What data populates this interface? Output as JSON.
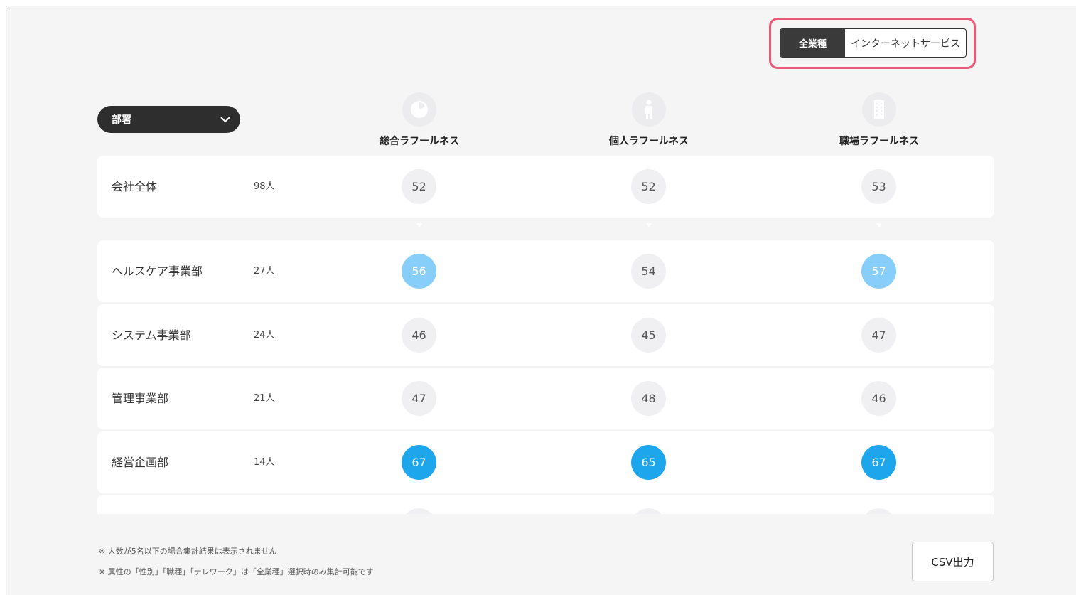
{
  "industry_toggle": {
    "active": "全業種",
    "inactive": "インターネットサービス"
  },
  "dept_select": {
    "value": "部署"
  },
  "columns": [
    {
      "label": "総合ラフールネス",
      "icon": "pie-icon"
    },
    {
      "label": "個人ラフールネス",
      "icon": "person-icon"
    },
    {
      "label": "職場ラフールネス",
      "icon": "building-icon"
    }
  ],
  "rows": [
    {
      "name": "会社全体",
      "count": "98人",
      "scores": [
        "52",
        "52",
        "53"
      ],
      "levels": [
        "neutral",
        "neutral",
        "neutral"
      ]
    },
    {
      "name": "ヘルスケア事業部",
      "count": "27人",
      "scores": [
        "56",
        "54",
        "57"
      ],
      "levels": [
        "light",
        "neutral",
        "light"
      ]
    },
    {
      "name": "システム事業部",
      "count": "24人",
      "scores": [
        "46",
        "45",
        "47"
      ],
      "levels": [
        "neutral",
        "neutral",
        "neutral"
      ]
    },
    {
      "name": "管理事業部",
      "count": "21人",
      "scores": [
        "47",
        "48",
        "46"
      ],
      "levels": [
        "neutral",
        "neutral",
        "neutral"
      ]
    },
    {
      "name": "経営企画部",
      "count": "14人",
      "scores": [
        "67",
        "65",
        "67"
      ],
      "levels": [
        "strong",
        "strong",
        "strong"
      ]
    }
  ],
  "notes": [
    "※ 人数が5名以下の場合集計結果は表示されません",
    "※ 属性の「性別」「職種」「テレワーク」は「全業種」選択時のみ集計可能です"
  ],
  "csv_button": "CSV出力",
  "colors": {
    "highlight": "#ea5a78",
    "score_light": "#87cffa",
    "score_strong": "#1ea6ec"
  }
}
